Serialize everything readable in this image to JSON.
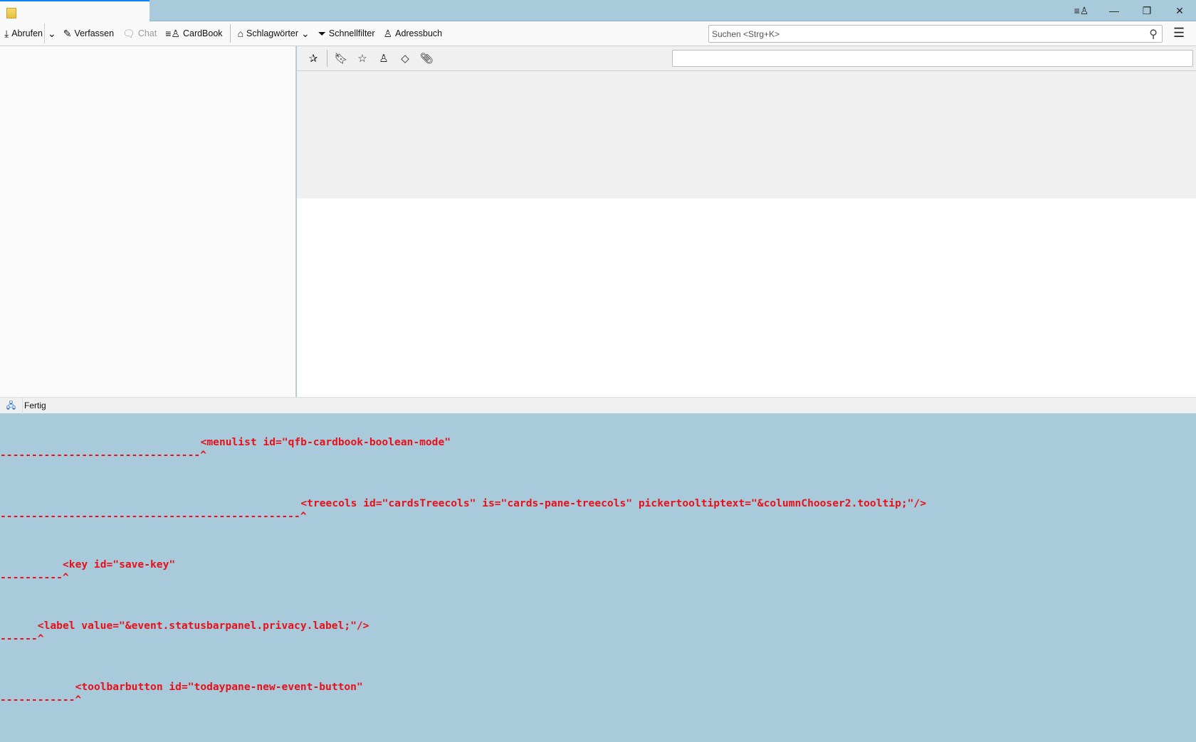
{
  "toolbar": {
    "get_mail": "Abrufen",
    "compose": "Verfassen",
    "chat": "Chat",
    "cardbook": "CardBook",
    "tags": "Schlagwörter",
    "quick_filter": "Schnellfilter",
    "address_book": "Adressbuch",
    "search_placeholder": "Suchen <Strg+K>"
  },
  "status": {
    "text": "Fertig"
  },
  "errors": [
    {
      "code": "<menulist id=\"qfb-cardbook-boolean-mode\"",
      "column": 32
    },
    {
      "code": "<treecols id=\"cardsTreecols\" is=\"cards-pane-treecols\" pickertooltiptext=\"&columnChooser2.tooltip;\"/>",
      "column": 48
    },
    {
      "code": "<key id=\"save-key\"",
      "column": 10
    },
    {
      "code": "<label value=\"&event.statusbarpanel.privacy.label;\"/>",
      "column": 6
    },
    {
      "code": "<toolbarbutton id=\"todaypane-new-event-button\"",
      "column": 12
    }
  ]
}
